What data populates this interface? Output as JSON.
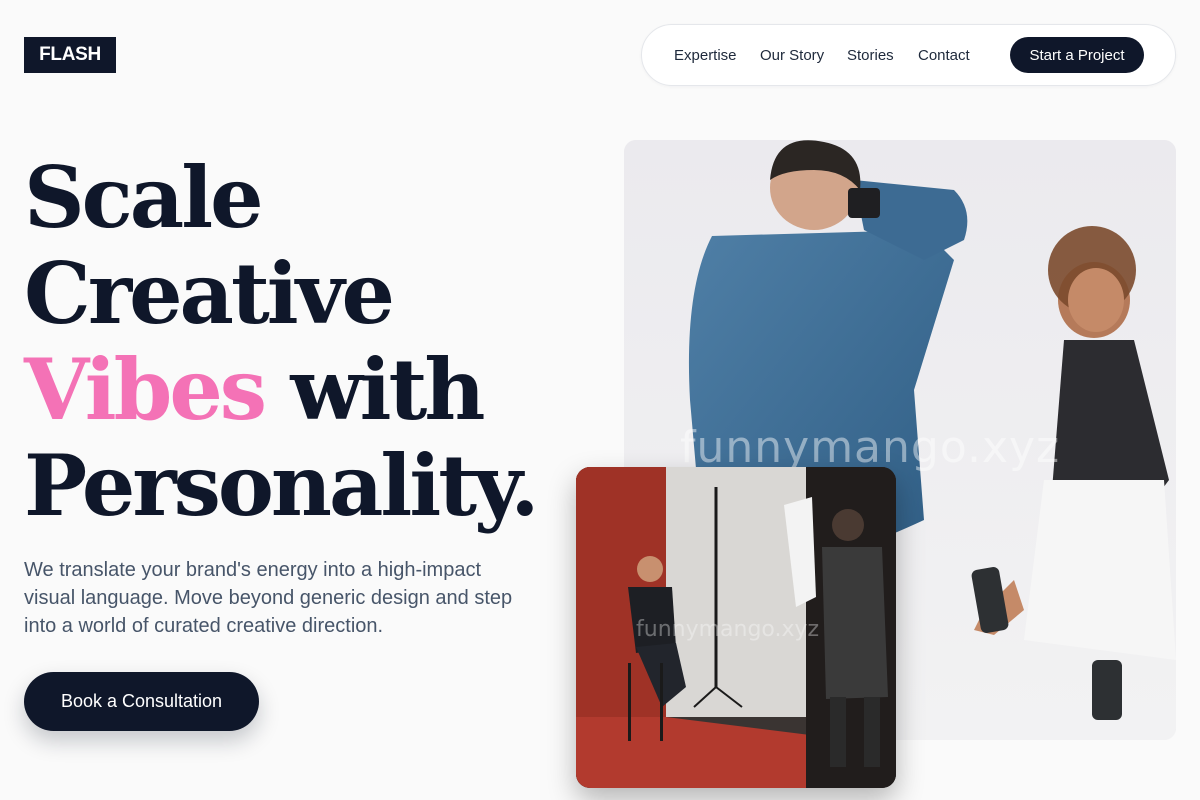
{
  "brand": {
    "logo": "FLASH"
  },
  "nav": {
    "links": [
      {
        "label": "Expertise"
      },
      {
        "label": "Our Story"
      },
      {
        "label": "Stories"
      },
      {
        "label": "Contact"
      }
    ],
    "cta_label": "Start a Project"
  },
  "hero": {
    "headline": {
      "line1": "Scale",
      "line2": "Creative",
      "line3_accent": "Vibes",
      "line3_rest": " with",
      "line4": "Personality."
    },
    "lead": "We translate your brand's energy into a high-impact visual language. Move beyond generic design and step into a world of curated creative direction.",
    "cta_label": "Book a Consultation"
  },
  "images": {
    "main": {
      "watermark": "funnymango.xyz"
    },
    "inset": {
      "watermark": "funnymango.xyz"
    }
  },
  "colors": {
    "primary": "#0f172a",
    "accent": "#f472b6",
    "background": "#fafafa",
    "body_text": "#475569"
  }
}
